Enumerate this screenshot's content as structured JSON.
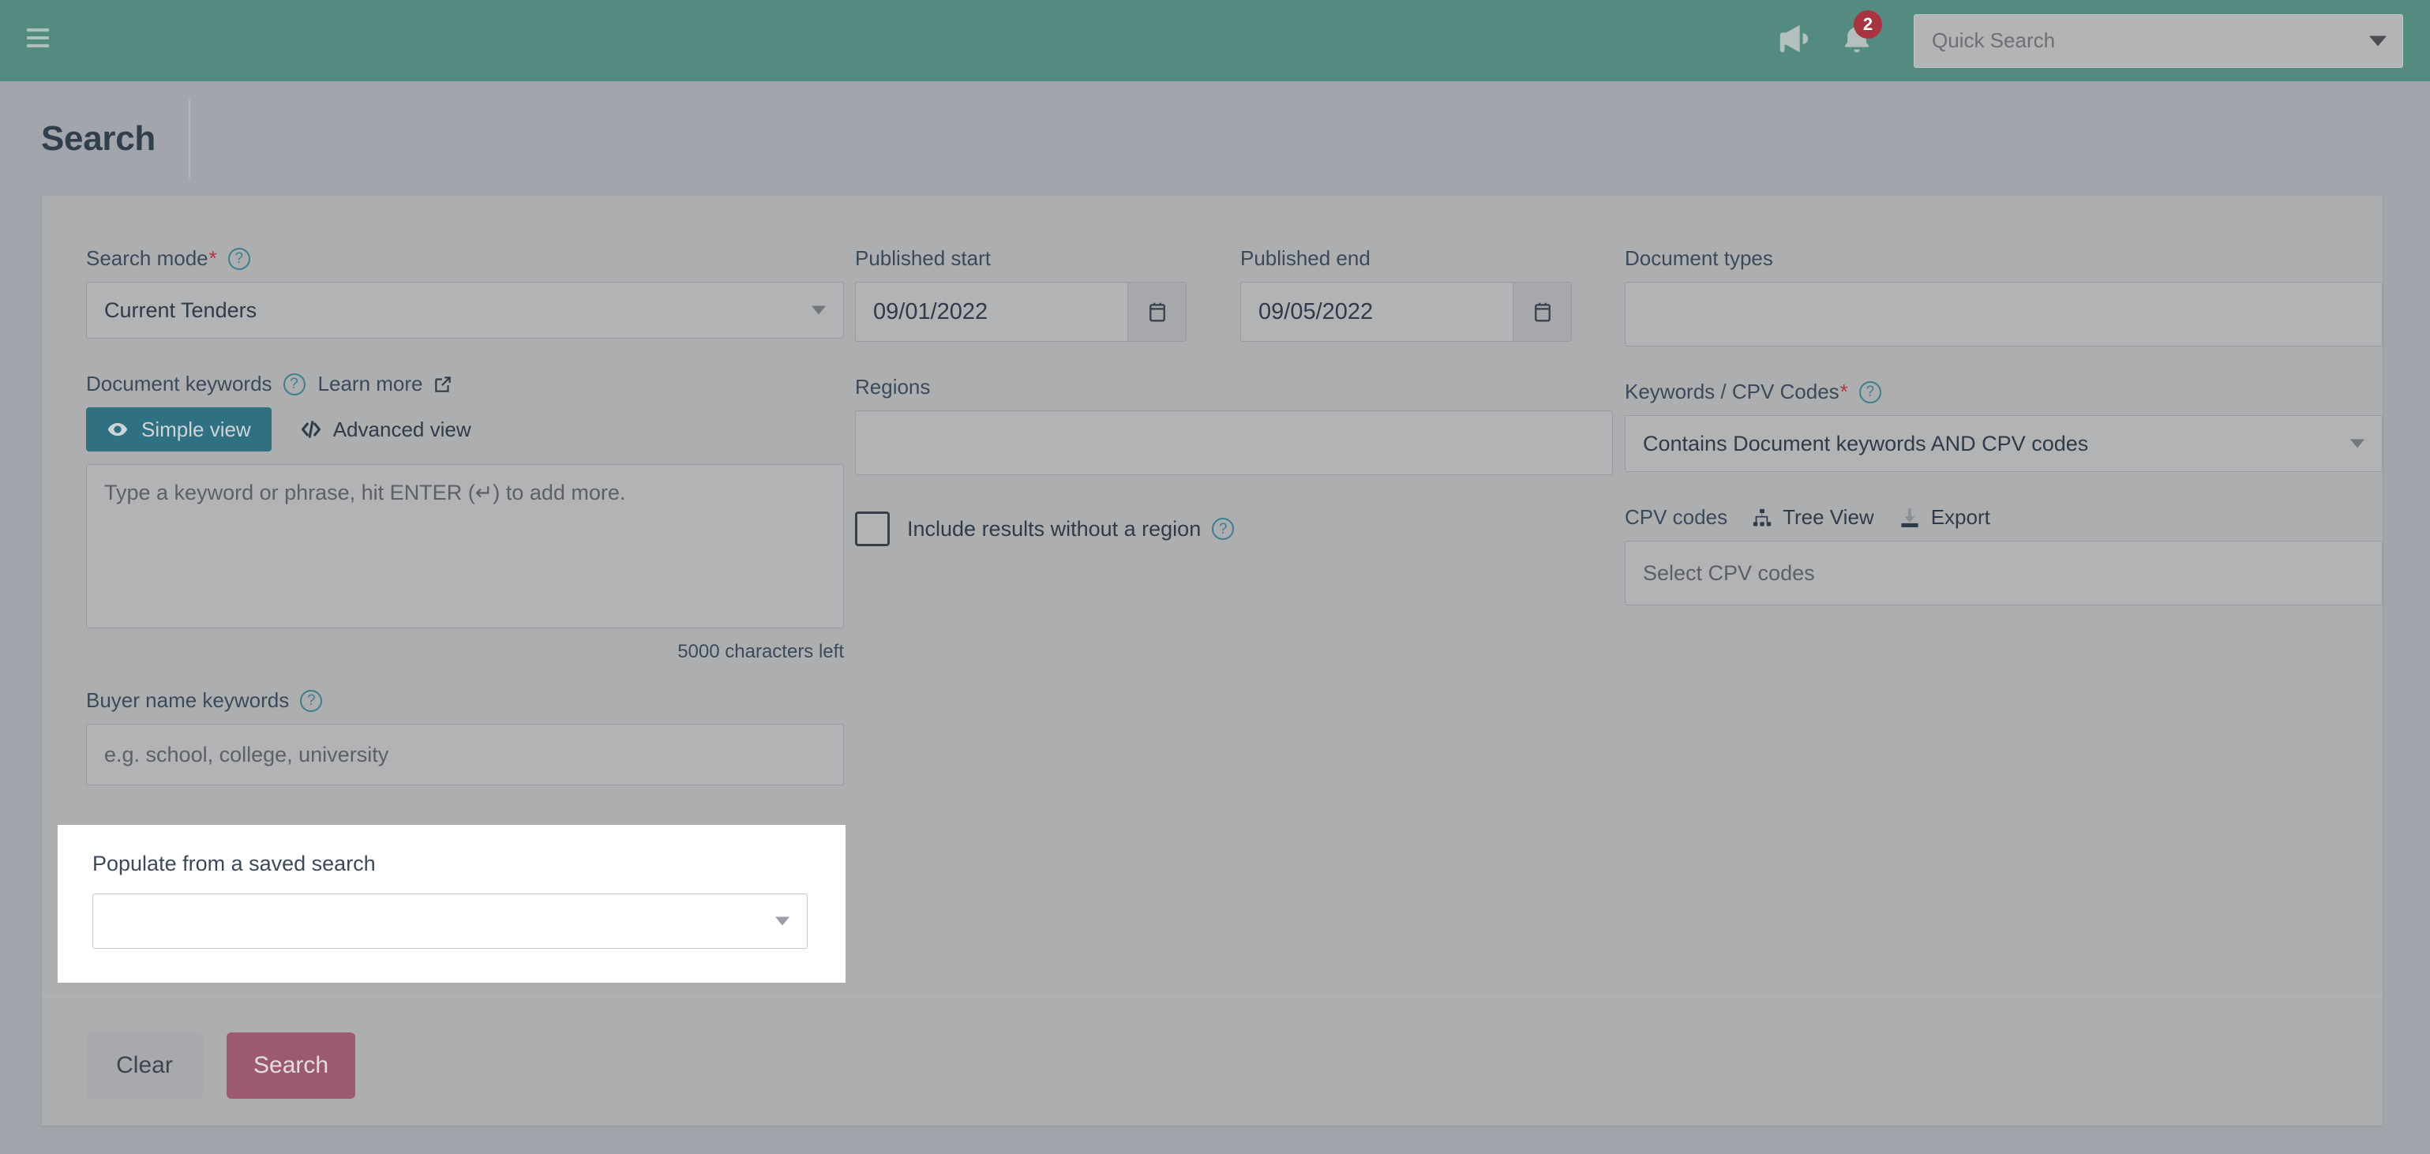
{
  "topbar": {
    "menu_icon": "hamburger-icon",
    "announcements_icon": "megaphone-icon",
    "notifications_icon": "bell-icon",
    "notification_count": "2",
    "quick_search_placeholder": "Quick Search",
    "background_color": "#548b81"
  },
  "page": {
    "title": "Search"
  },
  "search_mode": {
    "label": "Search mode",
    "required_marker": "*",
    "help_icon": "help-circle-icon",
    "value": "Current Tenders"
  },
  "document_keywords": {
    "label": "Document keywords",
    "help_icon": "help-circle-icon",
    "learn_more_label": "Learn more",
    "learn_more_icon": "external-link-icon",
    "simple_view_label": "Simple view",
    "simple_view_icon": "eye-icon",
    "advanced_view_label": "Advanced view",
    "advanced_view_icon": "code-icon",
    "textarea_placeholder": "Type a keyword or phrase, hit ENTER (↵) to add more.",
    "characters_left": "5000 characters left",
    "active_color": "#2f7183"
  },
  "buyer_name_keywords": {
    "label": "Buyer name keywords",
    "help_icon": "help-circle-icon",
    "placeholder": "e.g. school, college, university"
  },
  "published_start": {
    "label": "Published start",
    "value": "09/01/2022",
    "calendar_icon": "calendar-icon"
  },
  "published_end": {
    "label": "Published end",
    "value": "09/05/2022",
    "calendar_icon": "calendar-icon"
  },
  "regions": {
    "label": "Regions",
    "value": "",
    "include_no_region_label": "Include results without a region",
    "include_no_region_checked": false,
    "help_icon": "help-circle-icon"
  },
  "document_types": {
    "label": "Document types",
    "value": ""
  },
  "keywords_cpv": {
    "label": "Keywords / CPV Codes",
    "required_marker": "*",
    "help_icon": "help-circle-icon",
    "value": "Contains Document keywords AND CPV codes"
  },
  "cpv_codes": {
    "label": "CPV codes",
    "tree_view_label": "Tree View",
    "tree_view_icon": "sitemap-icon",
    "export_label": "Export",
    "export_icon": "download-icon",
    "placeholder": "Select CPV codes"
  },
  "saved_search_panel": {
    "label": "Populate from a saved search",
    "value": "",
    "caret_icon": "chevron-down-icon"
  },
  "footer": {
    "clear_label": "Clear",
    "search_label": "Search",
    "search_button_color": "#9c5a70"
  }
}
